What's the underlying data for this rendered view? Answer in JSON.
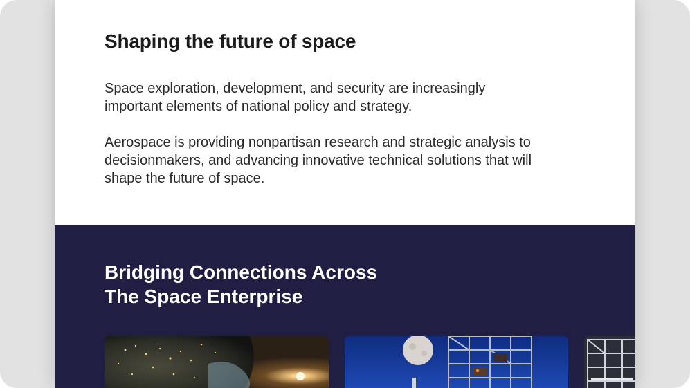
{
  "intro": {
    "title": "Shaping the future of space",
    "paragraph1": "Space exploration, development, and security are increasingly important elements of national policy and strategy.",
    "paragraph2": "Aerospace is providing nonpartisan research and strategic analysis to decisionmakers, and advancing innovative technical solutions that will shape the future of space."
  },
  "enterprise": {
    "title_line1": "Bridging Connections Across",
    "title_line2": "The Space Enterprise",
    "background": "#201f43"
  },
  "colors": {
    "page_bg": "#ffffff",
    "frame_bg": "#e2e2e2",
    "heading_text": "#1c1c1c",
    "body_text": "#2a2a2a"
  }
}
